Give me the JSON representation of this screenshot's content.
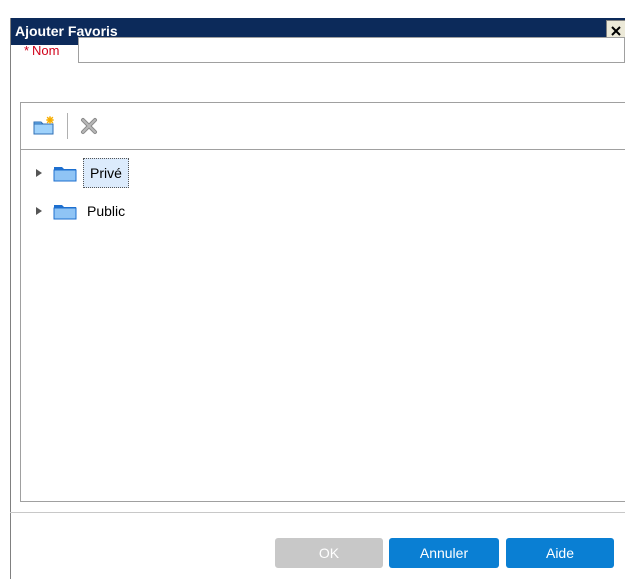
{
  "dialog": {
    "title": "Ajouter Favoris",
    "close_label": "×"
  },
  "form": {
    "required_marker": "*",
    "name_label": "Nom",
    "name_value": "",
    "name_placeholder": ""
  },
  "toolbar": {
    "new_folder_icon": "new-folder-icon",
    "delete_icon": "delete-icon"
  },
  "tree": {
    "items": [
      {
        "label": "Privé",
        "selected": true
      },
      {
        "label": "Public",
        "selected": false
      }
    ]
  },
  "buttons": {
    "ok": "OK",
    "annuler": "Annuler",
    "aide": "Aide"
  },
  "colors": {
    "titlebar": "#0c2a5a",
    "required": "#d0021b",
    "primary": "#0a7fd3",
    "disabled": "#c8c8c8",
    "selection": "#dcebfc"
  }
}
